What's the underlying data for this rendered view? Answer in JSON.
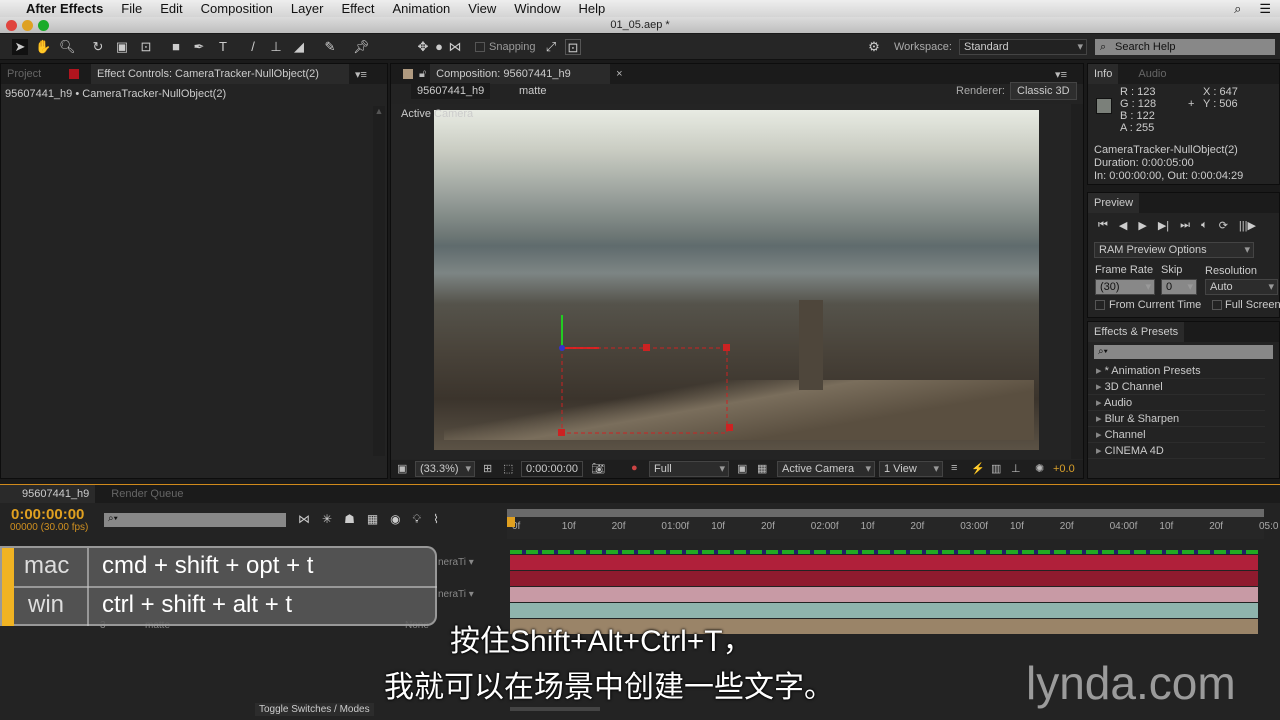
{
  "menubar": {
    "app": "After Effects",
    "items": [
      "File",
      "Edit",
      "Composition",
      "Layer",
      "Effect",
      "Animation",
      "View",
      "Window",
      "Help"
    ]
  },
  "window": {
    "title": "01_05.aep *"
  },
  "toolbar": {
    "snapping": "Snapping",
    "workspace_label": "Workspace:",
    "workspace": "Standard",
    "search_placeholder": "Search Help"
  },
  "left_panel": {
    "tabs": [
      "Project",
      "Effect Controls: CameraTracker-NullObject(2)"
    ],
    "breadcrumb": "95607441_h9 • CameraTracker-NullObject(2)"
  },
  "comp": {
    "tab": "Composition: 95607441_h9",
    "crumbs": [
      "95607441_h9",
      "matte"
    ],
    "renderer_label": "Renderer:",
    "renderer": "Classic 3D",
    "view_label": "Active Camera",
    "bottom": {
      "zoom": "(33.3%)",
      "time": "0:00:00:00",
      "resolution": "Full",
      "camera": "Active Camera",
      "views": "1 View",
      "exposure": "+0.0"
    }
  },
  "info": {
    "tabs": [
      "Info",
      "Audio"
    ],
    "r": "R : 123",
    "g": "G : 128",
    "b": "B : 122",
    "a": "A : 255",
    "x": "X : 647",
    "y": "Y : 506",
    "swatch": "#7b807a",
    "layer": "CameraTracker-NullObject(2)",
    "duration": "Duration: 0:00:05:00",
    "inout": "In: 0:00:00:00, Out: 0:00:04:29"
  },
  "preview": {
    "tab": "Preview",
    "ram": "RAM Preview Options",
    "frame_rate_label": "Frame Rate",
    "skip_label": "Skip",
    "resolution_label": "Resolution",
    "frame_rate": "(30)",
    "skip": "0",
    "resolution": "Auto",
    "from_current": "From Current Time",
    "full_screen": "Full Screen"
  },
  "effects": {
    "tab": "Effects & Presets",
    "items": [
      "* Animation Presets",
      "3D Channel",
      "Audio",
      "Blur & Sharpen",
      "Channel",
      "CINEMA 4D"
    ]
  },
  "timeline": {
    "tabs": [
      "95607441_h9",
      "Render Queue"
    ],
    "timecode": "0:00:00:00",
    "frames": "00000 (30.00 fps)",
    "ruler": [
      "0f",
      "10f",
      "20f",
      "01:00f",
      "10f",
      "20f",
      "02:00f",
      "10f",
      "20f",
      "03:00f",
      "10f",
      "20f",
      "04:00f",
      "10f",
      "20f",
      "05:0"
    ],
    "layer_name": "matte",
    "layer_num": "3",
    "parent": "None",
    "parent_short": "neraTi",
    "toggle": "Toggle Switches / Modes",
    "track_colors": [
      "#b0203a",
      "#8f1a2e",
      "#c89aa5",
      "#8fb4ad",
      "#9a8468"
    ]
  },
  "overlay": {
    "mac_label": "mac",
    "mac_keys": "cmd + shift + opt + t",
    "win_label": "win",
    "win_keys": "ctrl + shift + alt + t",
    "subtitle1": "按住Shift+Alt+Ctrl+T，",
    "subtitle2": "我就可以在场景中创建一些文字。",
    "logo": "lynda.com"
  }
}
